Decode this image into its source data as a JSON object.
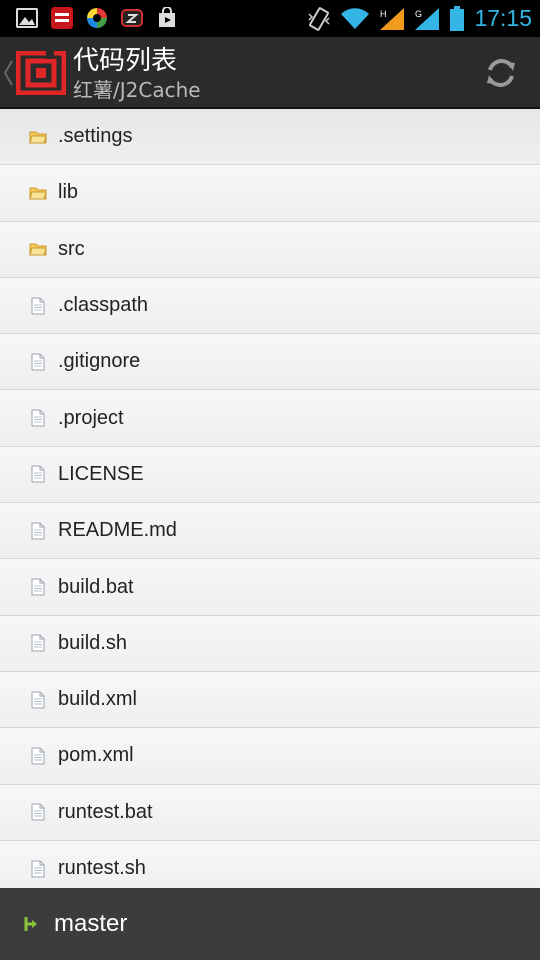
{
  "status_bar": {
    "time": "17:15",
    "left_icons": [
      "image-icon",
      "news-app-icon",
      "browser-app-icon",
      "zip-app-icon",
      "play-store-icon"
    ],
    "right_icons": [
      "vibrate-icon",
      "wifi-icon",
      "signal-icon",
      "signal-icon",
      "battery-icon"
    ],
    "colors": {
      "clock": "#33b5e5",
      "signal": "#f29a1e",
      "wifi": "#33b5e5"
    }
  },
  "action_bar": {
    "title": "代码列表",
    "subtitle": "红薯/J2Cache",
    "refresh_icon": "refresh-icon",
    "colors": {
      "background": "#2b2b2b",
      "logo": "#e02626"
    }
  },
  "files": [
    {
      "name": ".settings",
      "type": "folder"
    },
    {
      "name": "lib",
      "type": "folder"
    },
    {
      "name": "src",
      "type": "folder"
    },
    {
      "name": ".classpath",
      "type": "file"
    },
    {
      "name": ".gitignore",
      "type": "file"
    },
    {
      "name": ".project",
      "type": "file"
    },
    {
      "name": "LICENSE",
      "type": "file"
    },
    {
      "name": "README.md",
      "type": "file"
    },
    {
      "name": "build.bat",
      "type": "file"
    },
    {
      "name": "build.sh",
      "type": "file"
    },
    {
      "name": "build.xml",
      "type": "file"
    },
    {
      "name": "pom.xml",
      "type": "file"
    },
    {
      "name": "runtest.bat",
      "type": "file"
    },
    {
      "name": "runtest.sh",
      "type": "file"
    }
  ],
  "branch_bar": {
    "branch": "master",
    "icon": "branch-icon",
    "colors": {
      "icon": "#8ac33a"
    }
  }
}
